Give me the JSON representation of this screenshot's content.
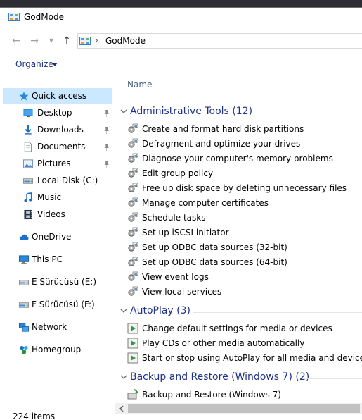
{
  "window": {
    "title": "GodMode",
    "title_icon": "control-panel-icon"
  },
  "navbar": {
    "back_icon": "back-arrow-icon",
    "forward_icon": "forward-arrow-icon",
    "recent_icon": "chevron-down-icon",
    "up_icon": "up-arrow-icon",
    "address": {
      "icon": "control-panel-icon",
      "separator": "›",
      "crumb": "GodMode"
    }
  },
  "commandbar": {
    "organize_label": "Organize"
  },
  "sidebar": {
    "items": [
      {
        "label": "Quick access",
        "icon": "star-icon",
        "selected": true
      },
      {
        "label": "Desktop",
        "icon": "desktop-folder-icon",
        "pinned": true
      },
      {
        "label": "Downloads",
        "icon": "download-arrow-icon",
        "pinned": true
      },
      {
        "label": "Documents",
        "icon": "documents-icon",
        "pinned": true
      },
      {
        "label": "Pictures",
        "icon": "pictures-icon",
        "pinned": true
      },
      {
        "label": "Local Disk (C:)",
        "icon": "drive-icon"
      },
      {
        "label": "Music",
        "icon": "music-note-icon"
      },
      {
        "label": "Videos",
        "icon": "film-icon"
      },
      {
        "label": "OneDrive",
        "icon": "cloud-icon"
      },
      {
        "label": "This PC",
        "icon": "computer-icon"
      },
      {
        "label": "E Sürücüsü (E:)",
        "icon": "drive-icon"
      },
      {
        "label": "F Sürücüsü (F:)",
        "icon": "drive-icon"
      },
      {
        "label": "Network",
        "icon": "network-icon"
      },
      {
        "label": "Homegroup",
        "icon": "homegroup-icon"
      }
    ]
  },
  "content": {
    "column_header": "Name",
    "groups": [
      {
        "title": "Administrative Tools (12)",
        "item_icon": "tools-gear-icon",
        "items": [
          "Create and format hard disk partitions",
          "Defragment and optimize your drives",
          "Diagnose your computer's memory problems",
          "Edit group policy",
          "Free up disk space by deleting unnecessary files",
          "Manage computer certificates",
          "Schedule tasks",
          "Set up iSCSI initiator",
          "Set up ODBC data sources (32-bit)",
          "Set up ODBC data sources (64-bit)",
          "View event logs",
          "View local services"
        ]
      },
      {
        "title": "AutoPlay (3)",
        "item_icon": "autoplay-icon",
        "items": [
          "Change default settings for media or devices",
          "Play CDs or other media automatically",
          "Start or stop using AutoPlay for all media and devices"
        ]
      },
      {
        "title": "Backup and Restore (Windows 7) (2)",
        "item_icon": "backup-restore-icon",
        "items": [
          "Backup and Restore (Windows 7)"
        ]
      }
    ]
  },
  "status": {
    "item_count": "224 items"
  },
  "colors": {
    "accent": "#1e3287",
    "selection": "#cce8ff",
    "header_text": "#4c607a"
  }
}
